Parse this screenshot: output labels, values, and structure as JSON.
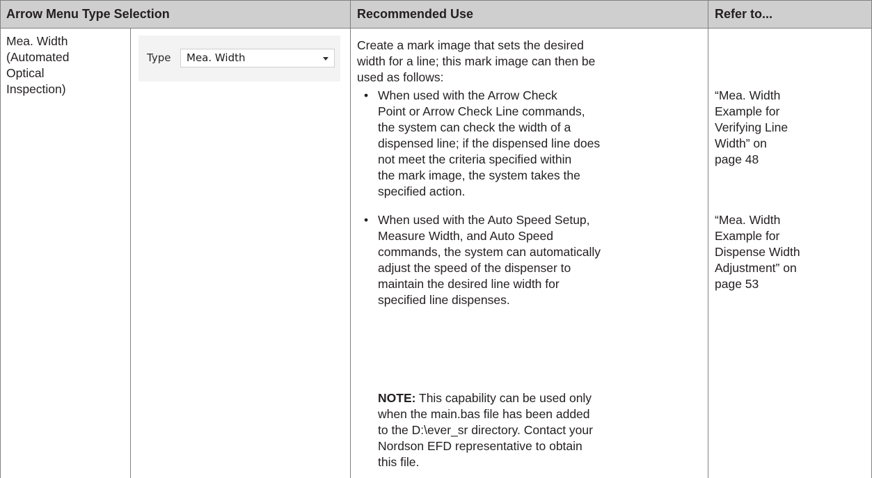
{
  "table": {
    "headers": {
      "col1": "Arrow Menu Type Selection",
      "col2": "Recommended Use",
      "col3": "Refer to..."
    },
    "row": {
      "type_name_lines": [
        "Mea. Width",
        "(Automated",
        "Optical",
        "Inspection)"
      ],
      "ui_snapshot": {
        "type_label": "Type",
        "type_value": "Mea. Width",
        "dropdown_icon": "chevron-down-icon"
      },
      "intro_lines": [
        "Create a mark image that sets the desired",
        "width for a line; this mark image can then be",
        "used as follows:"
      ],
      "bullets": [
        {
          "lines": [
            "When used with the Arrow Check",
            "Point or Arrow Check Line commands,",
            "the system can check the width of a",
            "dispensed line; if the dispensed line does",
            "not meet the criteria specified within",
            "the mark image, the system takes the",
            "specified action."
          ],
          "refer_lines": [
            "“Mea. Width",
            "Example for",
            "Verifying Line",
            "Width” on",
            "page 48"
          ]
        },
        {
          "lines": [
            "When used with the Auto Speed Setup,",
            "Measure Width, and Auto Speed",
            "commands, the system can automatically",
            "adjust the speed of the dispenser to",
            "maintain the desired line width for",
            "specified line dispenses."
          ],
          "refer_lines": [
            "“Mea. Width",
            "Example for",
            "Dispense Width",
            "Adjustment” on",
            "page 53"
          ]
        }
      ],
      "note": {
        "label": "NOTE:",
        "first_line_rest": " This capability can be used only",
        "lines": [
          "when the main.bas file has been added",
          "to the D:\\ever_sr directory. Contact your",
          "Nordson EFD representative to obtain",
          "this file."
        ]
      },
      "bullet_char": "•"
    }
  }
}
